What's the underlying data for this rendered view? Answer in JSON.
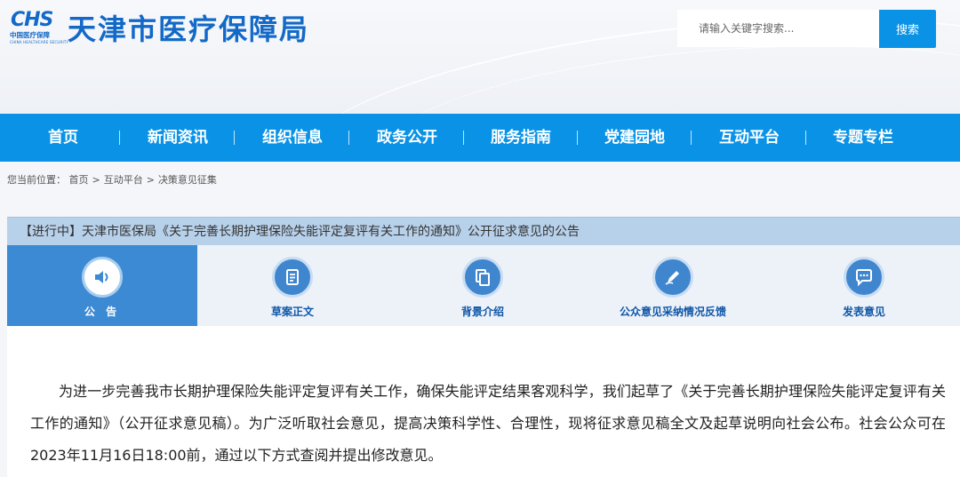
{
  "header": {
    "logo_mark": "CHS",
    "logo_cn": "中国医疗保障",
    "logo_en": "CHINA HEALTHCARE SECURITY",
    "site_title": "天津市医疗保障局",
    "search_placeholder": "请输入关键字搜索...",
    "search_button": "搜索"
  },
  "nav": {
    "items": [
      {
        "label": "首页"
      },
      {
        "label": "新闻资讯"
      },
      {
        "label": "组织信息"
      },
      {
        "label": "政务公开"
      },
      {
        "label": "服务指南"
      },
      {
        "label": "党建园地"
      },
      {
        "label": "互动平台"
      },
      {
        "label": "专题专栏"
      }
    ]
  },
  "breadcrumb": {
    "prefix": "您当前位置：",
    "items": [
      "首页",
      "互动平台",
      "决策意见征集"
    ],
    "separator": ">"
  },
  "notice": {
    "title": "【进行中】天津市医保局《关于完善长期护理保险失能评定复评有关工作的通知》公开征求意见的公告",
    "tabs": [
      {
        "label": "公 告",
        "icon": "speaker-icon",
        "active": true
      },
      {
        "label": "草案正文",
        "icon": "document-icon",
        "active": false
      },
      {
        "label": "背景介绍",
        "icon": "copy-icon",
        "active": false
      },
      {
        "label": "公众意见采纳情况反馈",
        "icon": "pen-icon",
        "active": false
      },
      {
        "label": "发表意见",
        "icon": "chat-icon",
        "active": false
      }
    ]
  },
  "content": {
    "paragraph": "为进一步完善我市长期护理保险失能评定复评有关工作，确保失能评定结果客观科学，我们起草了《关于完善长期护理保险失能评定复评有关工作的通知》（公开征求意见稿）。为广泛听取社会意见，提高决策科学性、合理性，现将征求意见稿全文及起草说明向社会公布。社会公众可在2023年11月16日18:00前，通过以下方式查阅并提出修改意见。"
  },
  "colors": {
    "brand_blue": "#1269c7",
    "nav_blue": "#0a93e6",
    "active_tab": "#3c8ad3",
    "tab_text": "#0e56a8"
  }
}
